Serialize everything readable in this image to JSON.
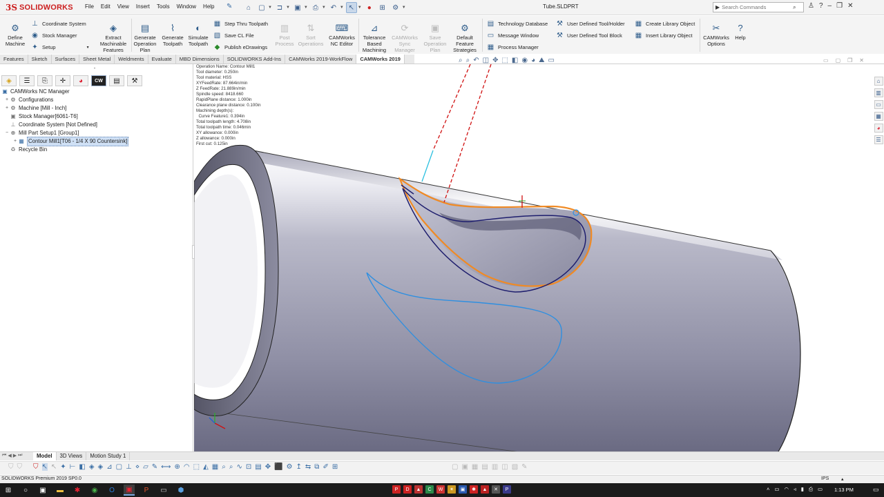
{
  "app": {
    "brand_ds": "3S",
    "brand_name": "SOLIDWORKS",
    "document_title": "Tube.SLDPRT"
  },
  "menus": [
    "File",
    "Edit",
    "View",
    "Insert",
    "Tools",
    "Window",
    "Help"
  ],
  "search": {
    "placeholder": "Search Commands"
  },
  "ribbon": {
    "define_machine": "Define\nMachine",
    "coordinate_system": "Coordinate System",
    "stock_manager": "Stock Manager",
    "setup": "Setup",
    "extract_features": "Extract\nMachinable\nFeatures",
    "generate_operation_plan": "Generate\nOperation\nPlan",
    "generate_toolpath": "Generate\nToolpath",
    "simulate_toolpath": "Simulate\nToolpath",
    "step_thru_toolpath": "Step Thru Toolpath",
    "save_cl_file": "Save CL File",
    "publish_edrawings": "Publish eDrawings",
    "post_process": "Post\nProcess",
    "sort_operations": "Sort\nOperations",
    "nc_editor": "CAMWorks\nNC Editor",
    "tolerance_machining": "Tolerance\nBased\nMachining",
    "sync_manager": "CAMWorks\nSync\nManager",
    "save_operation_plan": "Save\nOperation\nPlan",
    "default_strategies": "Default\nFeature\nStrategies",
    "technology_database": "Technology Database",
    "message_window": "Message Window",
    "process_manager": "Process Manager",
    "user_tool_holder": "User Defined Tool/Holder",
    "user_tool_block": "User Defined Tool Block",
    "create_library_object": "Create Library Object",
    "insert_library_object": "Insert Library Object",
    "camworks_options": "CAMWorks\nOptions",
    "help": "Help"
  },
  "tabs": [
    "Features",
    "Sketch",
    "Surfaces",
    "Sheet Metal",
    "Weldments",
    "Evaluate",
    "MBD Dimensions",
    "SOLIDWORKS Add-Ins",
    "CAMWorks 2019-WorkFlow",
    "CAMWorks 2019"
  ],
  "active_tab": "CAMWorks 2019",
  "tree": {
    "root": "CAMWorks NC Manager",
    "items": [
      "Configurations",
      "Machine [Mill - Inch]",
      "Stock Manager[6061-T6]",
      "Coordinate System [Not Defined]",
      "Mill Part Setup1 [Group1]",
      "Contour Mill1[T06 - 1/4 X 90 Countersink]",
      "Recycle Bin"
    ]
  },
  "operation_info": [
    "Operation Name: Contour Mill1",
    "Tool diameter: 0.250in",
    "Tool material: HSS",
    "XYFeedRate: 87.664in/min",
    "Z FeedRate: 21.889in/min",
    "Spindle speed: 8418.660",
    "RapidPlane distance: 1.000in",
    "Clearance plane distance: 0.100in",
    "Machining depth(s):",
    "  Curve Feature1: 0.394in",
    "Total toolpath length: 4.708in",
    "Total toolpath time: 0.046min",
    "XY allowance: 0.000in",
    "Z allowance: 0.000in",
    "First cut: 0.125in"
  ],
  "bottom_tabs": [
    "Model",
    "3D Views",
    "Motion Study 1"
  ],
  "status": {
    "left": "SOLIDWORKS Premium 2019 SP0.0",
    "units": "IPS"
  },
  "clock": "1:13 PM",
  "colors": {
    "accent": "#cc1f1f",
    "toolpath_orange": "#f08a24",
    "toolpath_navy": "#1e1e6e",
    "sketch_blue": "#2f8fe0",
    "rapid_red": "#d01010"
  }
}
